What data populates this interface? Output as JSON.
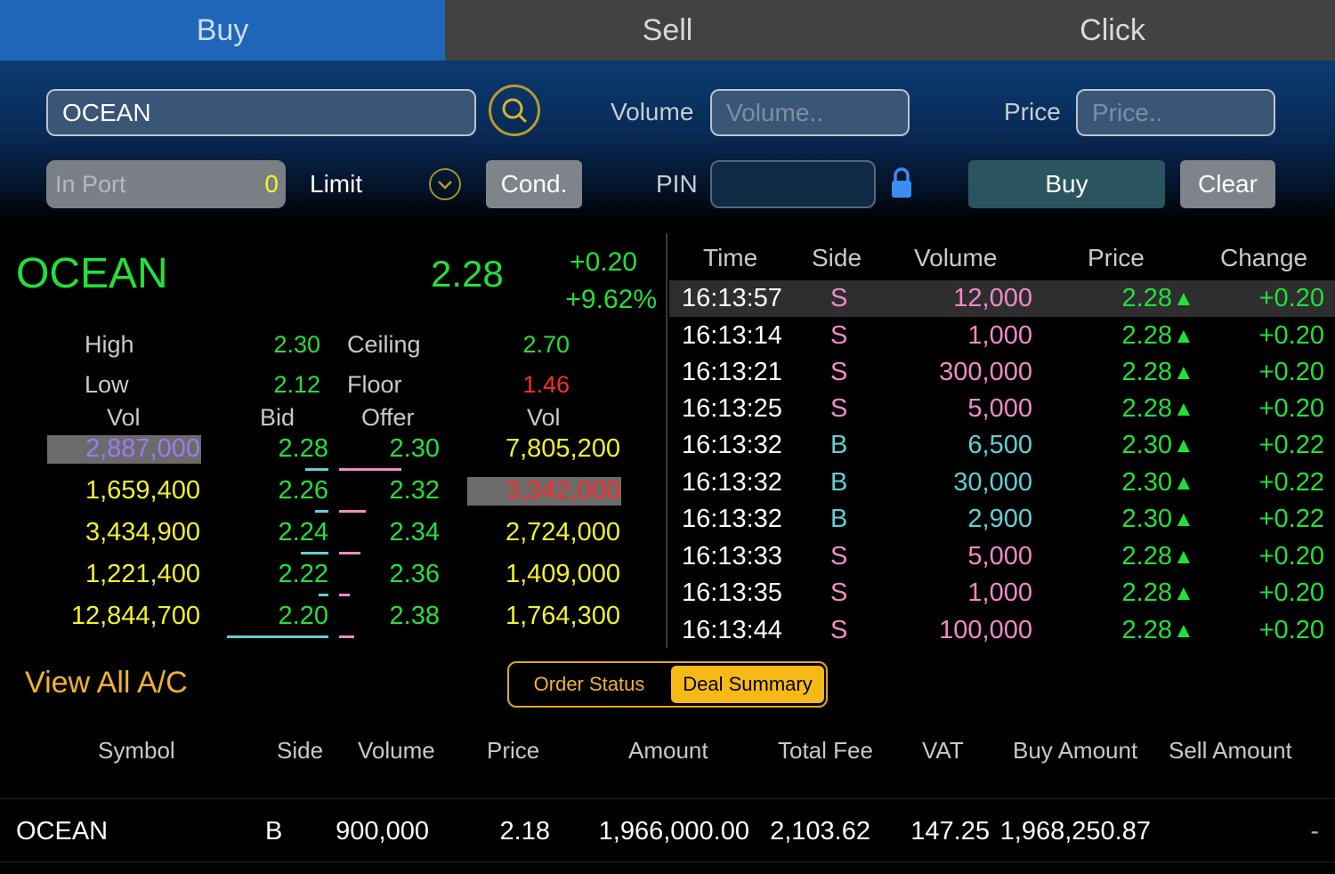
{
  "tabs": [
    "Buy",
    "Sell",
    "Click"
  ],
  "order_form": {
    "symbol_value": "OCEAN",
    "volume_label": "Volume",
    "volume_placeholder": "Volume..",
    "price_label": "Price",
    "price_placeholder": "Price..",
    "in_port_label": "In Port",
    "in_port_value": "0",
    "order_type": "Limit",
    "cond_label": "Cond.",
    "pin_label": "PIN",
    "buy_label": "Buy",
    "clear_label": "Clear"
  },
  "quote": {
    "symbol": "OCEAN",
    "last": "2.28",
    "change": "+0.20",
    "change_pct": "+9.62%",
    "high_label": "High",
    "high": "2.30",
    "low_label": "Low",
    "low": "2.12",
    "ceiling_label": "Ceiling",
    "ceiling": "2.70",
    "floor_label": "Floor",
    "floor": "1.46"
  },
  "order_book": {
    "headers": [
      "Vol",
      "Bid",
      "Offer",
      "Vol"
    ],
    "rows": [
      {
        "bid_vol": "2,887,000",
        "bid": "2.28",
        "offer": "2.30",
        "offer_vol": "7,805,200"
      },
      {
        "bid_vol": "1,659,400",
        "bid": "2.26",
        "offer": "2.32",
        "offer_vol": "3,342,000"
      },
      {
        "bid_vol": "3,434,900",
        "bid": "2.24",
        "offer": "2.34",
        "offer_vol": "2,724,000"
      },
      {
        "bid_vol": "1,221,400",
        "bid": "2.22",
        "offer": "2.36",
        "offer_vol": "1,409,000"
      },
      {
        "bid_vol": "12,844,700",
        "bid": "2.20",
        "offer": "2.38",
        "offer_vol": "1,764,300"
      }
    ]
  },
  "ticker": {
    "headers": [
      "Time",
      "Side",
      "Volume",
      "Price",
      "Change"
    ],
    "rows": [
      {
        "time": "16:13:57",
        "side": "S",
        "volume": "12,000",
        "price": "2.28",
        "change": "+0.20"
      },
      {
        "time": "16:13:14",
        "side": "S",
        "volume": "1,000",
        "price": "2.28",
        "change": "+0.20"
      },
      {
        "time": "16:13:21",
        "side": "S",
        "volume": "300,000",
        "price": "2.28",
        "change": "+0.20"
      },
      {
        "time": "16:13:25",
        "side": "S",
        "volume": "5,000",
        "price": "2.28",
        "change": "+0.20"
      },
      {
        "time": "16:13:32",
        "side": "B",
        "volume": "6,500",
        "price": "2.30",
        "change": "+0.22"
      },
      {
        "time": "16:13:32",
        "side": "B",
        "volume": "30,000",
        "price": "2.30",
        "change": "+0.22"
      },
      {
        "time": "16:13:32",
        "side": "B",
        "volume": "2,900",
        "price": "2.30",
        "change": "+0.22"
      },
      {
        "time": "16:13:33",
        "side": "S",
        "volume": "5,000",
        "price": "2.28",
        "change": "+0.20"
      },
      {
        "time": "16:13:35",
        "side": "S",
        "volume": "1,000",
        "price": "2.28",
        "change": "+0.20"
      },
      {
        "time": "16:13:44",
        "side": "S",
        "volume": "100,000",
        "price": "2.28",
        "change": "+0.20"
      }
    ]
  },
  "deal_section": {
    "view_all_label": "View All A/C",
    "seg_order_status": "Order Status",
    "seg_deal_summary": "Deal Summary",
    "headers": [
      "Symbol",
      "Side",
      "Volume",
      "Price",
      "Amount",
      "Total Fee",
      "VAT",
      "Buy Amount",
      "Sell Amount"
    ],
    "row": {
      "symbol": "OCEAN",
      "side": "B",
      "volume": "900,000",
      "price": "2.18",
      "amount": "1,966,000.00",
      "total_fee": "2,103.62",
      "vat": "147.25",
      "buy_amount": "1,968,250.87",
      "sell_amount": "-"
    }
  },
  "colors": {
    "buy_tab": "#1f66b8",
    "green": "#22e03a",
    "yellow": "#f3f32a",
    "red": "#ff2a2a",
    "accent_gold": "#e0a81e"
  }
}
